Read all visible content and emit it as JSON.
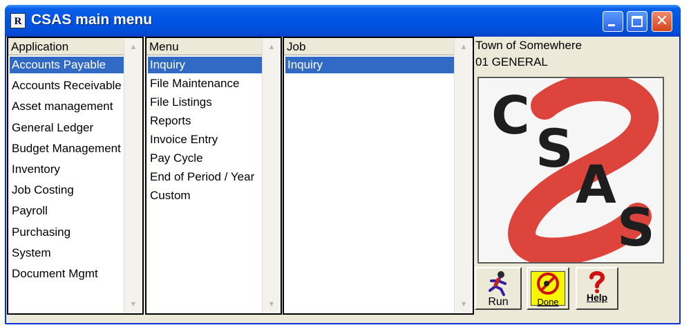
{
  "window": {
    "title": "CSAS main menu",
    "app_icon_glyph": "R"
  },
  "application_pane": {
    "header": "Application",
    "items": [
      "Accounts Payable",
      "Accounts Receivable",
      "Asset management",
      "General Ledger",
      "Budget Management",
      "Inventory",
      "Job Costing",
      "Payroll",
      "Purchasing",
      "System",
      "Document Mgmt"
    ],
    "selected_index": 0
  },
  "menu_pane": {
    "header": "Menu",
    "items": [
      "Inquiry",
      "File Maintenance",
      "File Listings",
      "Reports",
      "Invoice Entry",
      "Pay Cycle",
      "End of Period / Year",
      "Custom"
    ],
    "selected_index": 0
  },
  "job_pane": {
    "header": "Job",
    "items": [
      "Inquiry"
    ],
    "selected_index": 0
  },
  "info": {
    "organization": "Town of Somewhere",
    "fund": "01 GENERAL"
  },
  "logo": {
    "letters": [
      "C",
      "S",
      "A",
      "S"
    ],
    "accent_color": "#d9342b"
  },
  "buttons": {
    "run_label": "Run",
    "done_label": "Done",
    "help_label": "Help"
  },
  "colors": {
    "selection": "#316ac5",
    "titlebar": "#0054e3",
    "window_bg": "#ece9d8"
  }
}
